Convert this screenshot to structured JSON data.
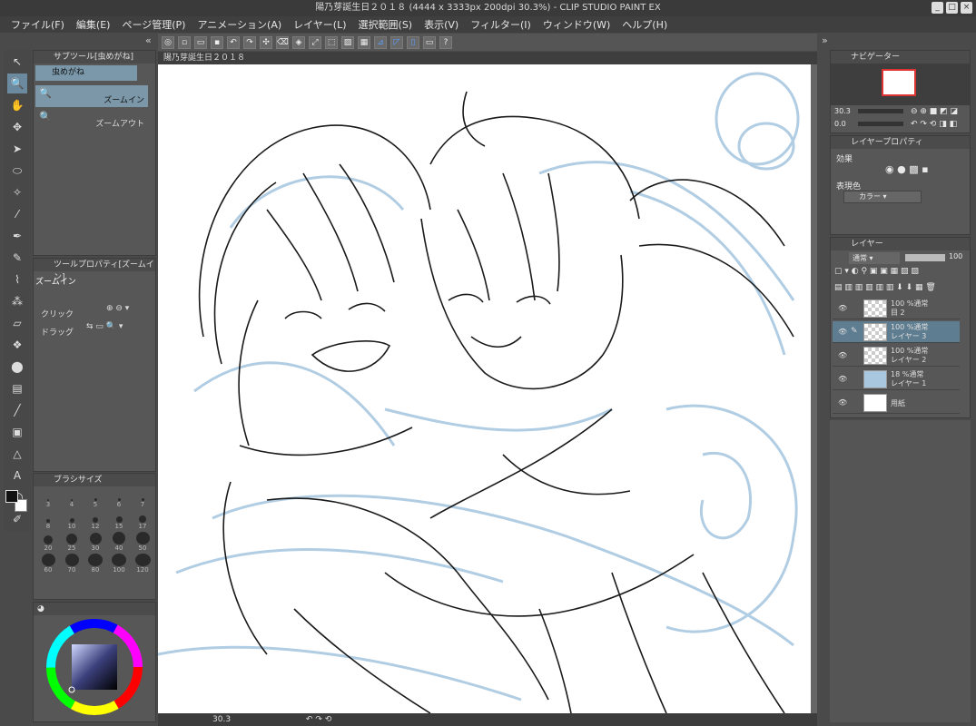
{
  "title": "陽乃芽誕生日２０１８ (4444 x 3333px 200dpi 30.3%) - CLIP STUDIO PAINT EX",
  "menu": [
    "ファイル(F)",
    "編集(E)",
    "ページ管理(P)",
    "アニメーション(A)",
    "レイヤー(L)",
    "選択範囲(S)",
    "表示(V)",
    "フィルター(I)",
    "ウィンドウ(W)",
    "ヘルプ(H)"
  ],
  "canvas_tab": "陽乃芽誕生日２０１８",
  "subtool": {
    "header": "サブツール[虫めがね]",
    "group_tab": "虫めがね",
    "items": [
      "ズームイン",
      "ズームアウト"
    ]
  },
  "toolprop": {
    "header": "ツールプロパティ[ズームイン]",
    "name": "ズームイン",
    "click_label": "クリック",
    "drag_label": "ドラッグ"
  },
  "brushsize": {
    "header": "ブラシサイズ",
    "sizes": [
      "3",
      "4",
      "5",
      "6",
      "7",
      "8",
      "10",
      "12",
      "15",
      "17",
      "20",
      "25",
      "30",
      "40",
      "50",
      "60",
      "70",
      "80",
      "100",
      "120"
    ]
  },
  "navigator": {
    "header": "ナビゲーター",
    "zoom": "30.3",
    "rotation": "0.0"
  },
  "layerprop": {
    "header": "レイヤープロパティ",
    "effect_label": "効果",
    "color_label": "表現色",
    "color_value": "カラー"
  },
  "layers": {
    "tab": "レイヤー",
    "blend": "通常",
    "opacity": "100",
    "rows": [
      {
        "line1": "100 %通常",
        "line2": "目 2"
      },
      {
        "line1": "100 %通常",
        "line2": "レイヤー 3"
      },
      {
        "line1": "100 %通常",
        "line2": "レイヤー 2"
      },
      {
        "line1": "18 %通常",
        "line2": "レイヤー 1"
      },
      {
        "line1": "",
        "line2": "用紙"
      }
    ]
  },
  "statusbar": {
    "zoom": "30.3"
  },
  "colors": {
    "sketch_blue": "#a9c8e0",
    "selection_blue": "#7a98aa"
  }
}
